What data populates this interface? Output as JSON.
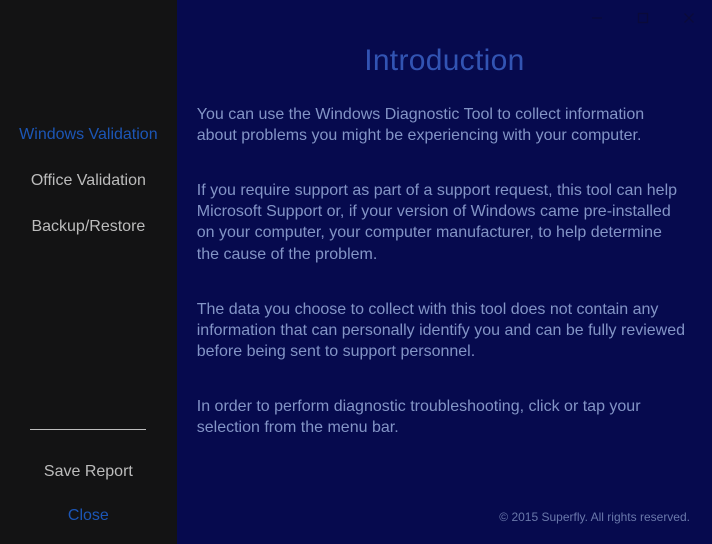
{
  "sidebar": {
    "items": [
      {
        "label": "Windows Validation",
        "selected": true
      },
      {
        "label": "Office Validation",
        "selected": false
      },
      {
        "label": "Backup/Restore",
        "selected": false
      }
    ],
    "actions": {
      "save_report": "Save Report",
      "close": "Close"
    }
  },
  "window_controls": {
    "minimize": "minimize",
    "maximize": "maximize",
    "close": "close"
  },
  "main": {
    "heading": "Introduction",
    "paragraphs": [
      "You can use the Windows Diagnostic Tool to collect information about problems you might be experiencing with your computer.",
      "If you require support as part of a support request, this tool can help Microsoft Support or, if your version of Windows came pre-installed on your computer, your computer manufacturer, to help determine the cause of the problem.",
      "The data you choose to collect with this tool does not contain any information that can personally identify you and can be fully reviewed before being sent to support personnel.",
      "In order to perform diagnostic troubleshooting, click or tap your selection from the menu bar."
    ],
    "footer": "© 2015 Superfly. All rights reserved."
  }
}
